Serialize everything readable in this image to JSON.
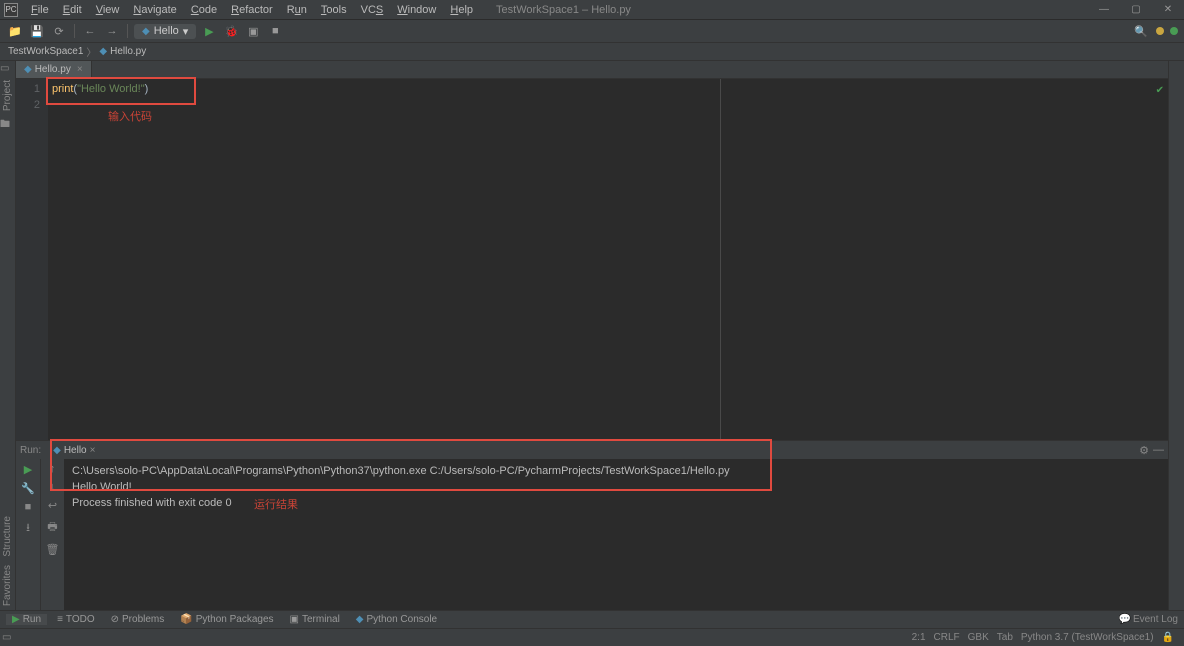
{
  "title": "TestWorkSpace1 – Hello.py",
  "menu": [
    "File",
    "Edit",
    "View",
    "Navigate",
    "Code",
    "Refactor",
    "Run",
    "Tools",
    "VCS",
    "Window",
    "Help"
  ],
  "runConfig": "Hello",
  "breadcrumb": {
    "a": "TestWorkSpace1",
    "b": "Hello.py"
  },
  "fileTab": "Hello.py",
  "code": {
    "line1": {
      "fn": "print",
      "open": "(",
      "str": "\"Hello World!\"",
      "close": ")"
    },
    "lineNumbers": [
      "1",
      "2"
    ]
  },
  "annotations": {
    "input": "输入代码",
    "result": "运行结果"
  },
  "runPanelLabel": "Run:",
  "runTab": "Hello",
  "output": {
    "cmd": "C:\\Users\\solo-PC\\AppData\\Local\\Programs\\Python\\Python37\\python.exe C:/Users/solo-PC/PycharmProjects/TestWorkSpace1/Hello.py",
    "out": "Hello World!",
    "blank": "",
    "exit": "Process finished with exit code 0"
  },
  "bottomTools": {
    "run": "Run",
    "todo": "TODO",
    "problems": "Problems",
    "pkgs": "Python Packages",
    "terminal": "Terminal",
    "console": "Python Console"
  },
  "eventLog": "Event Log",
  "status": {
    "pos": "2:1",
    "crlf": "CRLF",
    "enc": "GBK",
    "tab": "Tab",
    "python": "Python 3.7 (TestWorkSpace1)"
  },
  "sideTools": {
    "project": "Project",
    "structure": "Structure",
    "favorites": "Favorites"
  }
}
